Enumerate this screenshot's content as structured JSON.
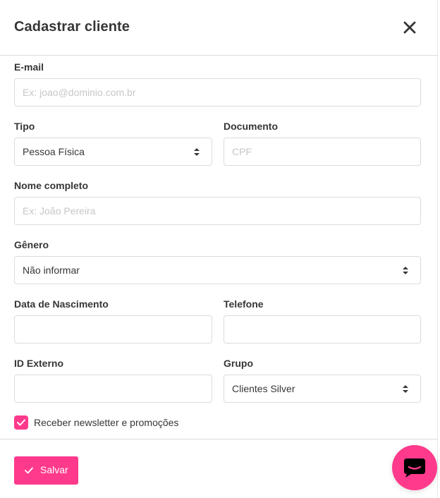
{
  "modal": {
    "title": "Cadastrar cliente",
    "close_icon": "close-icon"
  },
  "form": {
    "email": {
      "label": "E-mail",
      "placeholder": "Ex: joao@dominio.com.br",
      "value": ""
    },
    "tipo": {
      "label": "Tipo",
      "value": "Pessoa Física"
    },
    "documento": {
      "label": "Documento",
      "placeholder": "CPF",
      "value": ""
    },
    "nome": {
      "label": "Nome completo",
      "placeholder": "Ex: João Pereira",
      "value": ""
    },
    "genero": {
      "label": "Gênero",
      "value": "Não informar"
    },
    "nascimento": {
      "label": "Data de Nascimento",
      "value": ""
    },
    "telefone": {
      "label": "Telefone",
      "value": ""
    },
    "id_externo": {
      "label": "ID Externo",
      "value": ""
    },
    "grupo": {
      "label": "Grupo",
      "value": "Clientes Silver"
    },
    "newsletter": {
      "label": "Receber newsletter e promoções",
      "checked": true
    }
  },
  "footer": {
    "save_label": "Salvar",
    "save_icon": "check-icon"
  },
  "chat": {
    "icon": "chat-icon"
  },
  "colors": {
    "accent": "#ff3a8c",
    "border": "#dbdbdb",
    "text": "#363636",
    "placeholder": "#c7c7c7"
  }
}
